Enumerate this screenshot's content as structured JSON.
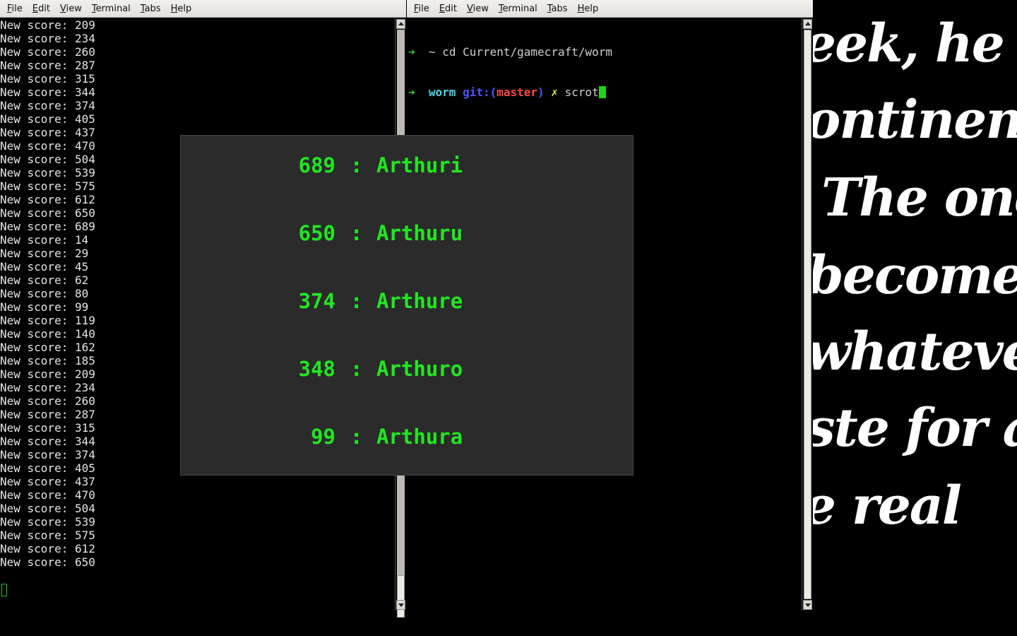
{
  "left_terminal": {
    "menu": [
      "File",
      "Edit",
      "View",
      "Terminal",
      "Tabs",
      "Help"
    ],
    "lines": [
      "New score: 209",
      "New score: 234",
      "New score: 260",
      "New score: 287",
      "New score: 315",
      "New score: 344",
      "New score: 374",
      "New score: 405",
      "New score: 437",
      "New score: 470",
      "New score: 504",
      "New score: 539",
      "New score: 575",
      "New score: 612",
      "New score: 650",
      "New score: 689",
      "New score: 14",
      "New score: 29",
      "New score: 45",
      "New score: 62",
      "New score: 80",
      "New score: 99",
      "New score: 119",
      "New score: 140",
      "New score: 162",
      "New score: 185",
      "New score: 209",
      "New score: 234",
      "New score: 260",
      "New score: 287",
      "New score: 315",
      "New score: 344",
      "New score: 374",
      "New score: 405",
      "New score: 437",
      "New score: 470",
      "New score: 504",
      "New score: 539",
      "New score: 575",
      "New score: 612",
      "New score: 650"
    ]
  },
  "right_terminal": {
    "menu": [
      "File",
      "Edit",
      "View",
      "Terminal",
      "Tabs",
      "Help"
    ],
    "line1": {
      "arrow": "➜",
      "path": "~",
      "command": "cd Current/gamecraft/worm"
    },
    "line2": {
      "arrow": "➜",
      "repo": "worm",
      "git_prefix": "git:(",
      "branch": "master",
      "git_suffix": ")",
      "dirty": "✗",
      "command": "scrot"
    }
  },
  "scoreboard": [
    {
      "score": "689",
      "sep": ":",
      "name": "Arthuri"
    },
    {
      "score": "650",
      "sep": ":",
      "name": "Arthuru"
    },
    {
      "score": "374",
      "sep": ":",
      "name": "Arthure"
    },
    {
      "score": "348",
      "sep": ":",
      "name": "Arthuro"
    },
    {
      "score": "99",
      "sep": ":",
      "name": "Arthura"
    }
  ],
  "wallpaper_lines": [
    "eek, he",
    "ontinent",
    "The one",
    "becomes",
    "whatever",
    "ste for a",
    "e real"
  ],
  "colors": {
    "score_text": "#22e622",
    "panel_bg": "#2b2b2b",
    "terminal_bg": "#000000"
  }
}
